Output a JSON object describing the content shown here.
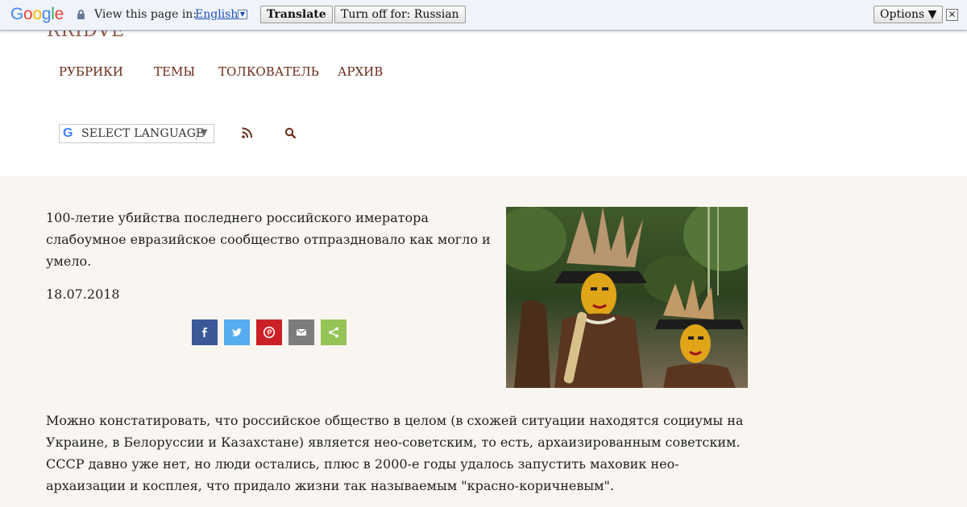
{
  "translate_bar": {
    "logo": "Google",
    "prompt": "View this page in:",
    "language": "English",
    "translate_label": "Translate",
    "turn_off_label": "Turn off for: Russian",
    "options_label": "Options ▼",
    "close_glyph": "✕"
  },
  "header": {
    "logo_fragment": "RRIDVE",
    "nav": [
      "РУБРИКИ",
      "ТЕМЫ",
      "ТОЛКОВАТЕЛЬ",
      "АРХИВ"
    ],
    "language_select": "SELECT LANGUAGE",
    "language_select_arrow": "▼",
    "icons": [
      "rss-icon",
      "search-icon"
    ],
    "accent": "#6b2a18"
  },
  "article": {
    "lead": "100-летие убийства последнего российского имератора слабоумное евразийское сообщество отпраздновало как могло и умело.",
    "date": "18.07.2018",
    "share_buttons": [
      {
        "name": "facebook",
        "color": "#3b5998"
      },
      {
        "name": "twitter",
        "color": "#55acee"
      },
      {
        "name": "pinterest",
        "color": "#cb2027"
      },
      {
        "name": "email",
        "color": "#7d7d7d"
      },
      {
        "name": "share",
        "color": "#95c355"
      }
    ],
    "body": "Можно констатировать, что российское общество в целом (в схожей ситуации находятся социумы на Украине, в Белоруссии и Казахстане) является нео-советским, то есть, архаизированным советским. СССР давно уже нет, но люди остались, плюс в 2000-е годы удалось запустить маховик нео-архаизации и косплея, что придало жизни так называемым \"красно-коричневым\"."
  }
}
